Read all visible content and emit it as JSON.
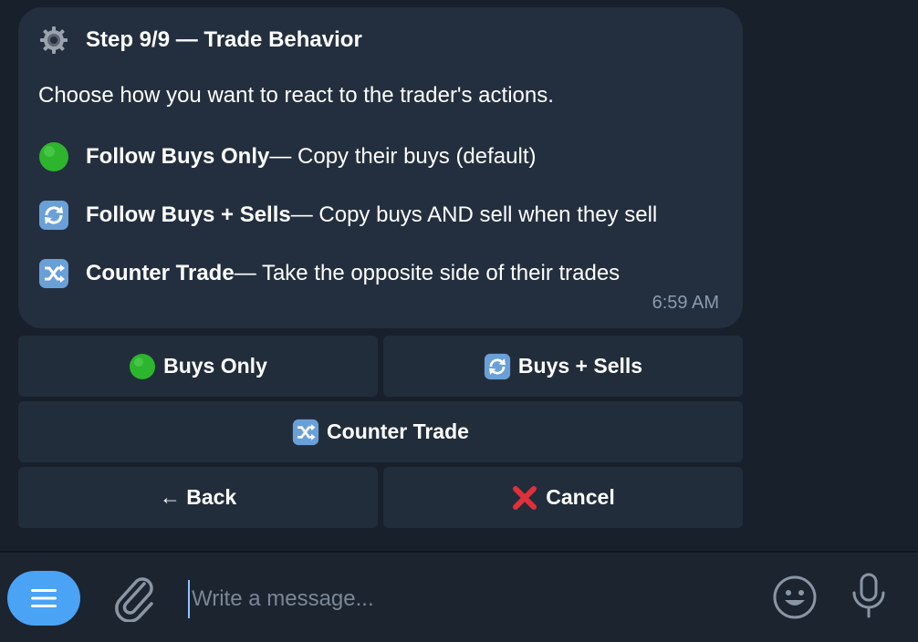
{
  "message": {
    "title": "Step 9/9 — Trade Behavior",
    "title_icon": "gear-icon",
    "intro": "Choose how you want to react to the trader's actions.",
    "options": [
      {
        "icon": "green-circle-icon",
        "name": "Follow Buys Only",
        "desc": " — Copy their buys (default)"
      },
      {
        "icon": "repeat-arrows-icon",
        "name": "Follow Buys + Sells",
        "desc": " — Copy buys AND sell when they sell"
      },
      {
        "icon": "shuffle-icon",
        "name": "Counter Trade",
        "desc": " — Take the opposite side of their trades"
      }
    ],
    "time": "6:59 AM"
  },
  "keyboard": {
    "buys_only": "Buys Only",
    "buys_sells": "Buys + Sells",
    "counter_trade": "Counter Trade",
    "back": "← Back",
    "cancel": "Cancel"
  },
  "composer": {
    "placeholder": "Write a message..."
  },
  "colors": {
    "background": "#18202c",
    "bubble": "#232f3f",
    "button": "#222d3c",
    "accent": "#4aa3f5",
    "green": "#2db52d",
    "cancel_red": "#e0303a",
    "icon_blue": "#6aa0d8"
  }
}
